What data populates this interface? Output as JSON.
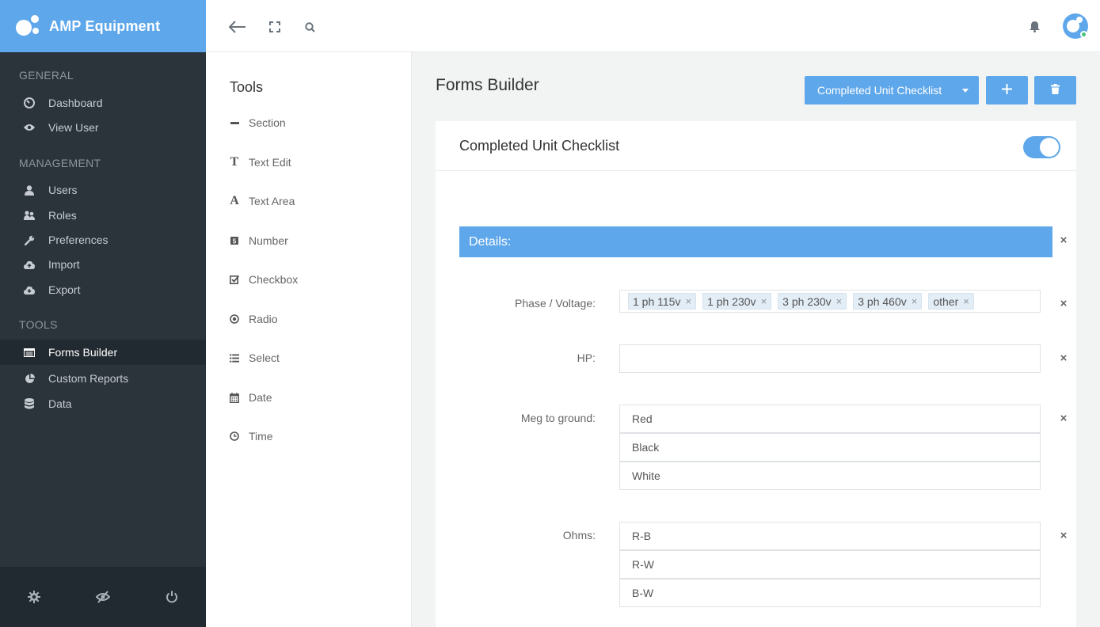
{
  "brand": {
    "name": "AMP Equipment"
  },
  "sidebar": {
    "sections": [
      {
        "label": "GENERAL",
        "items": [
          {
            "label": "Dashboard",
            "icon": "dashboard-icon"
          },
          {
            "label": "View User",
            "icon": "eye-icon"
          }
        ]
      },
      {
        "label": "MANAGEMENT",
        "items": [
          {
            "label": "Users",
            "icon": "user-icon"
          },
          {
            "label": "Roles",
            "icon": "users-icon"
          },
          {
            "label": "Preferences",
            "icon": "wrench-icon"
          },
          {
            "label": "Import",
            "icon": "cloud-upload-icon"
          },
          {
            "label": "Export",
            "icon": "cloud-download-icon"
          }
        ]
      },
      {
        "label": "TOOLS",
        "items": [
          {
            "label": "Forms Builder",
            "icon": "form-icon",
            "active": true
          },
          {
            "label": "Custom Reports",
            "icon": "pie-chart-icon"
          },
          {
            "label": "Data",
            "icon": "database-icon"
          }
        ]
      }
    ],
    "footer": [
      "gear-icon",
      "eye-slash-icon",
      "power-icon"
    ]
  },
  "tools": {
    "title": "Tools",
    "items": [
      {
        "label": "Section",
        "icon": "minus-icon"
      },
      {
        "label": "Text Edit",
        "icon": "text-icon"
      },
      {
        "label": "Text Area",
        "icon": "font-icon"
      },
      {
        "label": "Number",
        "icon": "number-icon"
      },
      {
        "label": "Checkbox",
        "icon": "checkbox-icon"
      },
      {
        "label": "Radio",
        "icon": "radio-icon"
      },
      {
        "label": "Select",
        "icon": "list-icon"
      },
      {
        "label": "Date",
        "icon": "calendar-icon"
      },
      {
        "label": "Time",
        "icon": "clock-icon"
      }
    ]
  },
  "main": {
    "title": "Forms Builder",
    "form_select": "Completed Unit Checklist",
    "card": {
      "title": "Completed Unit Checklist",
      "enabled": true,
      "section_label": "Details:",
      "fields": {
        "phase": {
          "label": "Phase / Voltage:",
          "tags": [
            "1 ph 115v",
            "1 ph 230v",
            "3 ph 230v",
            "3 ph 460v",
            "other"
          ]
        },
        "hp": {
          "label": "HP:",
          "value": ""
        },
        "meg": {
          "label": "Meg to ground:",
          "options": [
            "Red",
            "Black",
            "White"
          ]
        },
        "ohms": {
          "label": "Ohms:",
          "options": [
            "R-B",
            "R-W",
            "B-W"
          ]
        }
      }
    }
  },
  "colors": {
    "accent": "#5ea7ea",
    "sidebar_bg": "#2b333b",
    "sidebar_active": "#222a31"
  }
}
